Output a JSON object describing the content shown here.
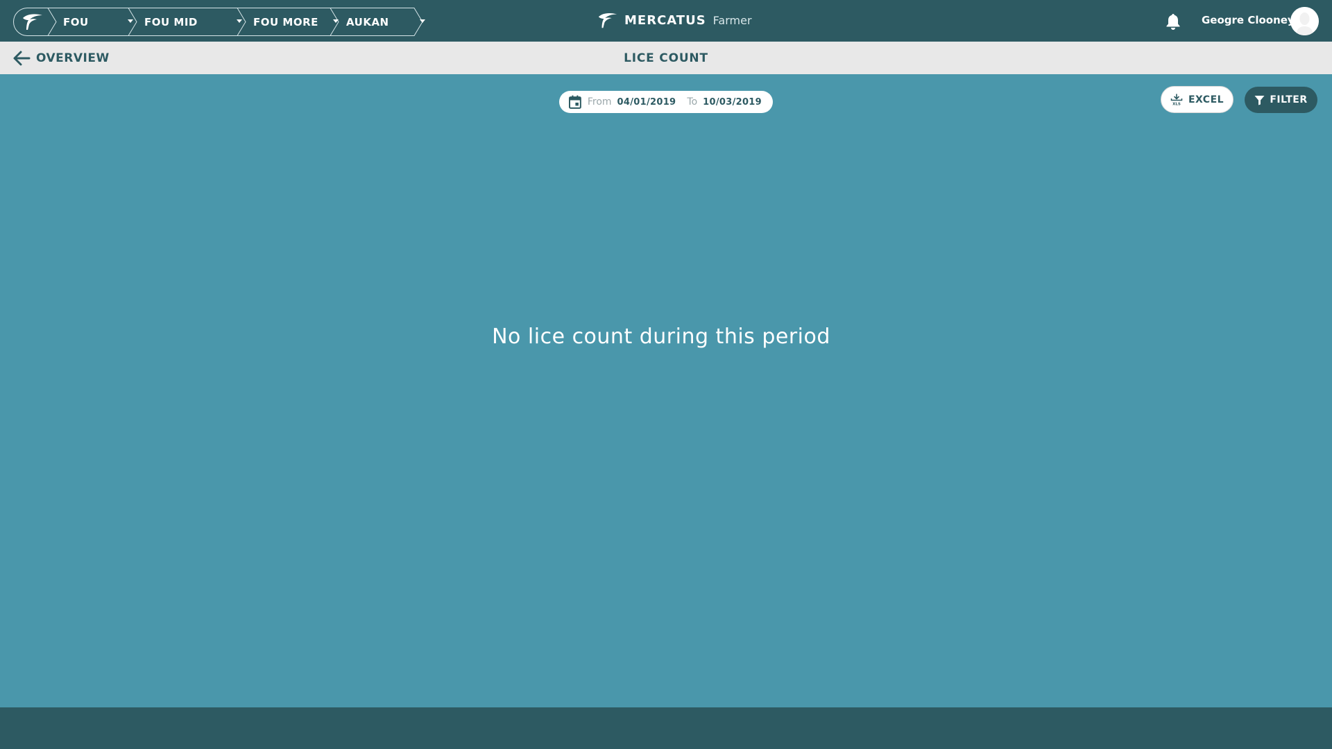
{
  "breadcrumbs": [
    {
      "label": "FOU"
    },
    {
      "label": "FOU MID"
    },
    {
      "label": "FOU MORE"
    },
    {
      "label": "AUKAN"
    }
  ],
  "brand": {
    "name": "MERCATUS",
    "role": "Farmer"
  },
  "user": {
    "name": "Geogre Clooney"
  },
  "subbar": {
    "back_label": "OVERVIEW",
    "title": "LICE COUNT",
    "excel_label": "EXCEL",
    "filter_label": "FILTER"
  },
  "date_range": {
    "from_label": "From",
    "from_value": "04/01/2019",
    "to_label": "To",
    "to_value": "10/03/2019"
  },
  "content": {
    "empty_message": "No lice count during this period"
  },
  "icons": {
    "home": "fish-logo-icon",
    "caret": "caret-down-icon",
    "notifications": "bell-icon",
    "back": "arrow-left-icon",
    "excel": "xls-download-icon",
    "filter": "funnel-icon",
    "calendar": "calendar-icon"
  },
  "colors": {
    "primary": "#2d5a62",
    "background": "#4a97ab",
    "subbar": "#e8e8e8"
  }
}
